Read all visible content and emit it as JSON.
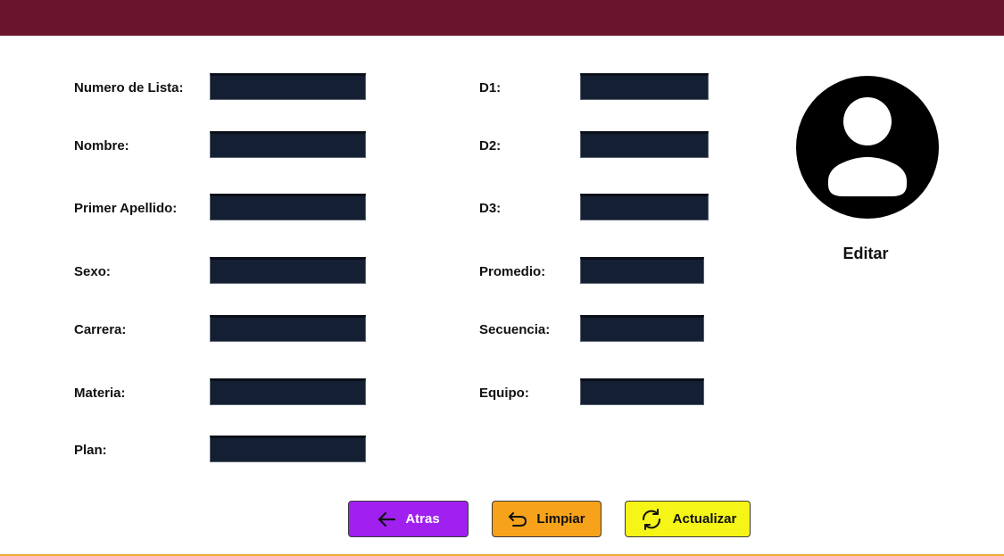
{
  "form": {
    "left_fields": [
      {
        "label": "Numero de Lista:",
        "value": ""
      },
      {
        "label": "Nombre:",
        "value": ""
      },
      {
        "label": "Primer Apellido:",
        "value": ""
      },
      {
        "label": "Sexo:",
        "value": ""
      },
      {
        "label": "Carrera:",
        "value": ""
      },
      {
        "label": "Materia:",
        "value": ""
      },
      {
        "label": "Plan:",
        "value": ""
      }
    ],
    "right_fields": [
      {
        "label": "D1:",
        "value": ""
      },
      {
        "label": "D2:",
        "value": ""
      },
      {
        "label": "D3:",
        "value": ""
      },
      {
        "label": "Promedio:",
        "value": ""
      },
      {
        "label": "Secuencia:",
        "value": ""
      },
      {
        "label": "Equipo:",
        "value": ""
      }
    ]
  },
  "avatar": {
    "icon": "user-avatar-icon",
    "label": "Editar"
  },
  "buttons": {
    "back": {
      "label": "Atras",
      "icon": "arrow-left-icon",
      "color": "#a020f0"
    },
    "clear": {
      "label": "Limpiar",
      "icon": "undo-icon",
      "color": "#f7a21b"
    },
    "update": {
      "label": "Actualizar",
      "icon": "refresh-icon",
      "color": "#f5f518"
    }
  },
  "colors": {
    "header": "#6b142d",
    "field_bg": "#141f33",
    "bottom_line": "#f2a93b"
  }
}
